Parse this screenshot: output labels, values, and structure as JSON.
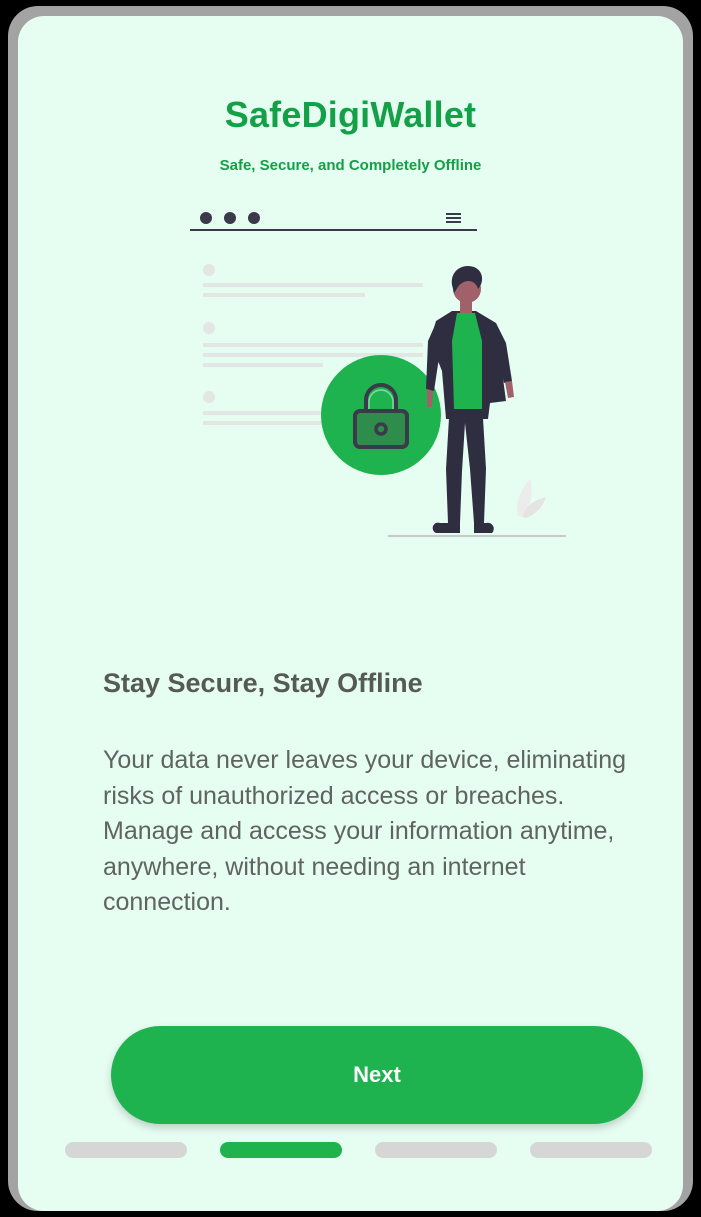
{
  "app": {
    "title": "SafeDigiWallet",
    "subtitle": "Safe, Secure, and Completely Offline"
  },
  "illustration": {
    "icon_name": "person-with-padlock-illustration"
  },
  "content": {
    "heading": "Stay Secure, Stay Offline",
    "body": "Your data never leaves your device, eliminating risks of unauthorized access or breaches. Manage and access your information anytime, anywhere, without needing an internet connection."
  },
  "actions": {
    "next_label": "Next"
  },
  "pagination": {
    "total_pages": 4,
    "active_index": 1
  },
  "colors": {
    "accent": "#1fb350",
    "background": "#e6fdf2",
    "heading_text": "#555a55",
    "inactive_indicator": "#d6d6d6"
  }
}
